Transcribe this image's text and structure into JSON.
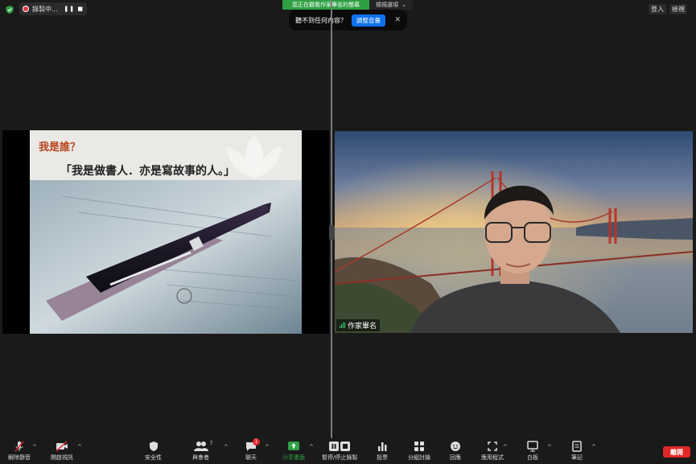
{
  "topbar": {
    "recording_label": "錄製中...",
    "recording_controls": "❚❚ ■",
    "viewing_banner": "您正在觀看作家畢名的螢幕",
    "view_options": "檢視選項",
    "view_options_caret": "⌄",
    "login": "登入",
    "view_button": "檢視"
  },
  "audio_tip": {
    "message": "聽不到任何內容？",
    "adjust_button": "調整音量",
    "close": "✕"
  },
  "slide": {
    "title": "我是誰？",
    "subtitle": "「我是做書人．亦是寫故事的人。」"
  },
  "video": {
    "participant_name": "作家畢名"
  },
  "toolbar": {
    "unmute": "解除靜音",
    "start_video": "開啟視訊",
    "security": "安全性",
    "participants": "與會者",
    "participants_count": "7",
    "chat": "聊天",
    "chat_badge": "1",
    "share_screen": "分享畫面",
    "pause_recording": "暫停/停止錄製",
    "polls": "投票",
    "breakout_rooms": "分組討論",
    "reactions": "回應",
    "apps": "應用程式",
    "whiteboard": "白板",
    "notes": "筆記",
    "end": "離開"
  },
  "colors": {
    "share_green": "#2ea043",
    "end_red": "#e02828",
    "accent_blue": "#0e72ed"
  }
}
